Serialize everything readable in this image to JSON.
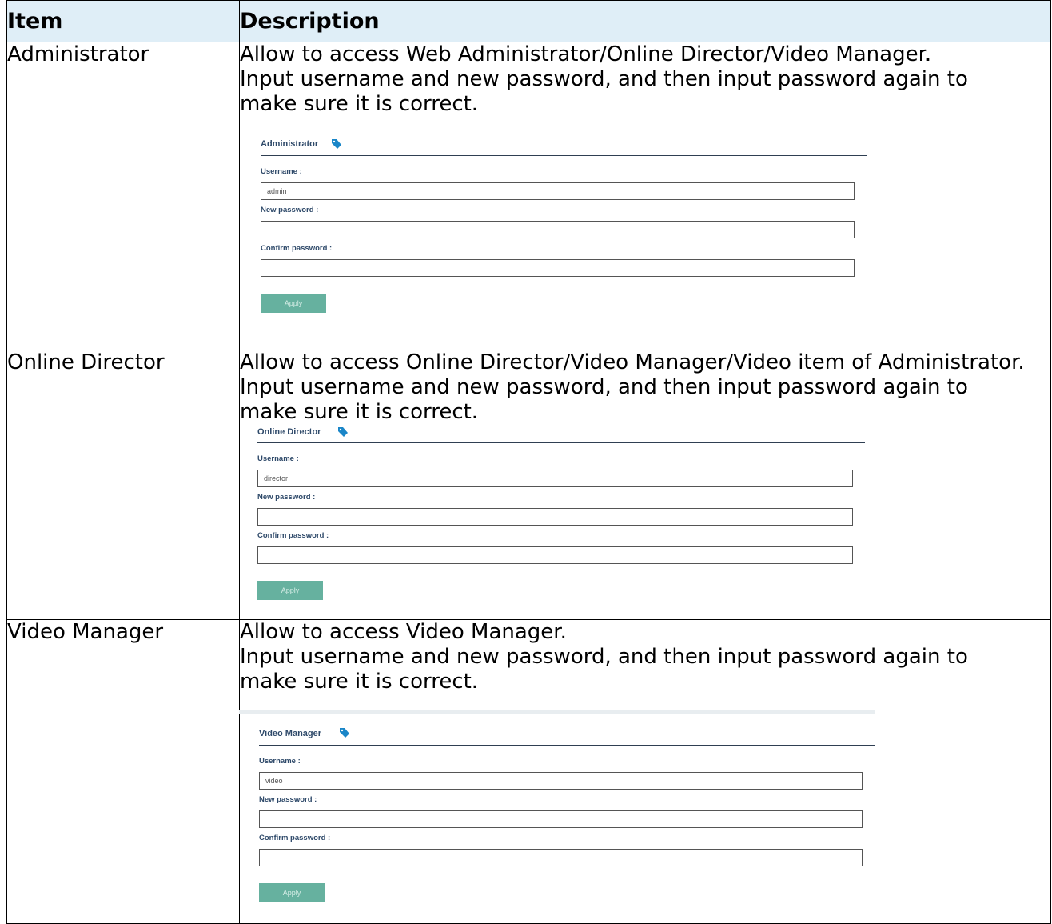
{
  "table": {
    "headers": {
      "item": "Item",
      "description": "Description"
    },
    "rows": [
      {
        "item": "Administrator",
        "description": [
          "Allow to access Web Administrator/Online Director/Video Manager.",
          "Input username and new password, and then input password again to",
          "make sure it is correct."
        ],
        "form": {
          "title": "Administrator",
          "icon": "tag-icon",
          "username_label": "Username :",
          "username_value": "admin",
          "new_password_label": "New password :",
          "new_password_value": "",
          "confirm_password_label": "Confirm password :",
          "confirm_password_value": "",
          "apply_label": "Apply"
        }
      },
      {
        "item": "Online Director",
        "description": [
          "Allow to access Online Director/Video Manager/Video item of Administrator.",
          "Input username and new password, and then input password again to",
          "make sure it is correct."
        ],
        "form": {
          "title": "Online Director",
          "icon": "tag-icon",
          "username_label": "Username :",
          "username_value": "director",
          "new_password_label": "New password :",
          "new_password_value": "",
          "confirm_password_label": "Confirm password :",
          "confirm_password_value": "",
          "apply_label": "Apply"
        }
      },
      {
        "item": "Video Manager",
        "description": [
          "Allow to access Video Manager.",
          "Input username and new password, and then input password again to",
          "make sure it is correct."
        ],
        "form": {
          "title": "Video Manager",
          "icon": "tag-icon",
          "username_label": "Username :",
          "username_value": "video",
          "new_password_label": "New password :",
          "new_password_value": "",
          "confirm_password_label": "Confirm password :",
          "confirm_password_value": "",
          "apply_label": "Apply"
        }
      }
    ]
  },
  "colors": {
    "header_background": "#dfeef7",
    "form_title": "#2f4a6a",
    "apply_button": "#66b19f",
    "tag_icon": "#1a86c8"
  }
}
